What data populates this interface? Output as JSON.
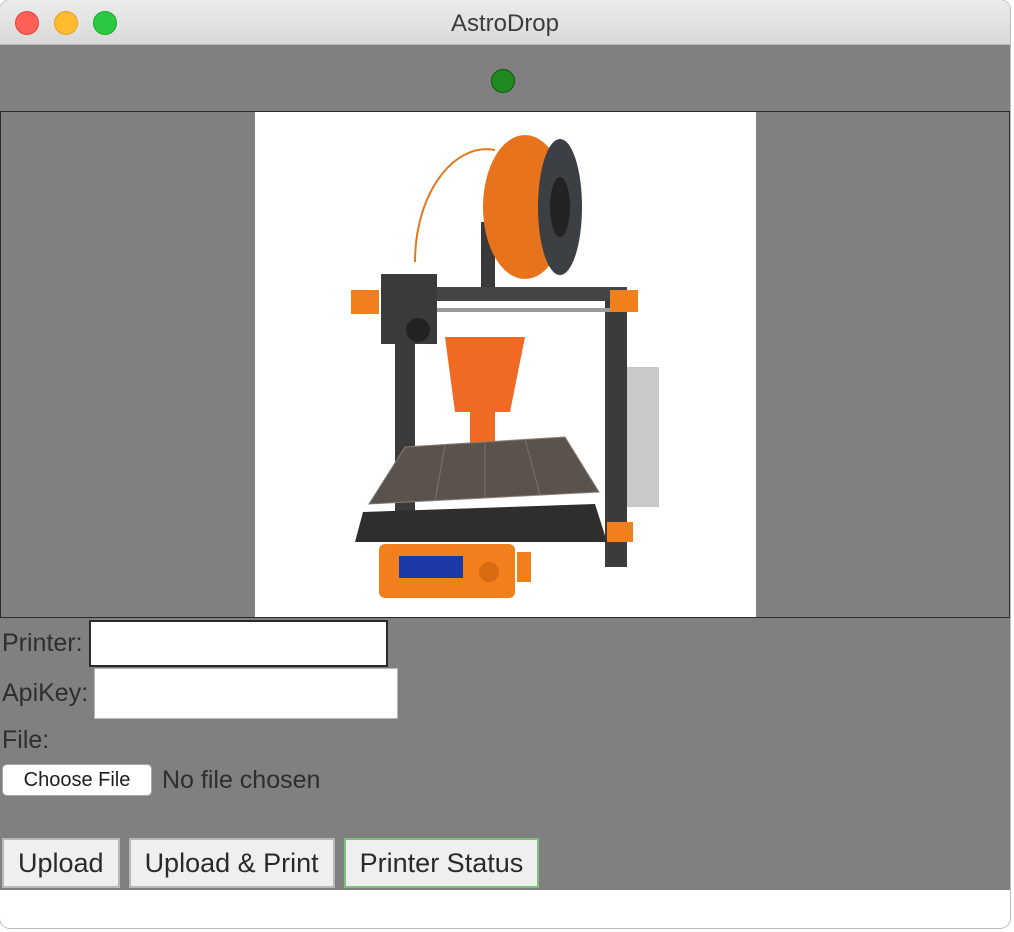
{
  "window": {
    "title": "AstroDrop"
  },
  "status": {
    "indicator_color": "#1f8a1f"
  },
  "image": {
    "alt": "Orange and black 3D printer with an orange printed bust on the bed"
  },
  "form": {
    "printer_label": "Printer:",
    "printer_value": "",
    "apikey_label": "ApiKey:",
    "apikey_value": "",
    "file_label": "File:",
    "choose_file_label": "Choose File",
    "no_file_text": "No file chosen"
  },
  "actions": {
    "upload_label": "Upload",
    "upload_print_label": "Upload & Print",
    "printer_status_label": "Printer Status"
  }
}
